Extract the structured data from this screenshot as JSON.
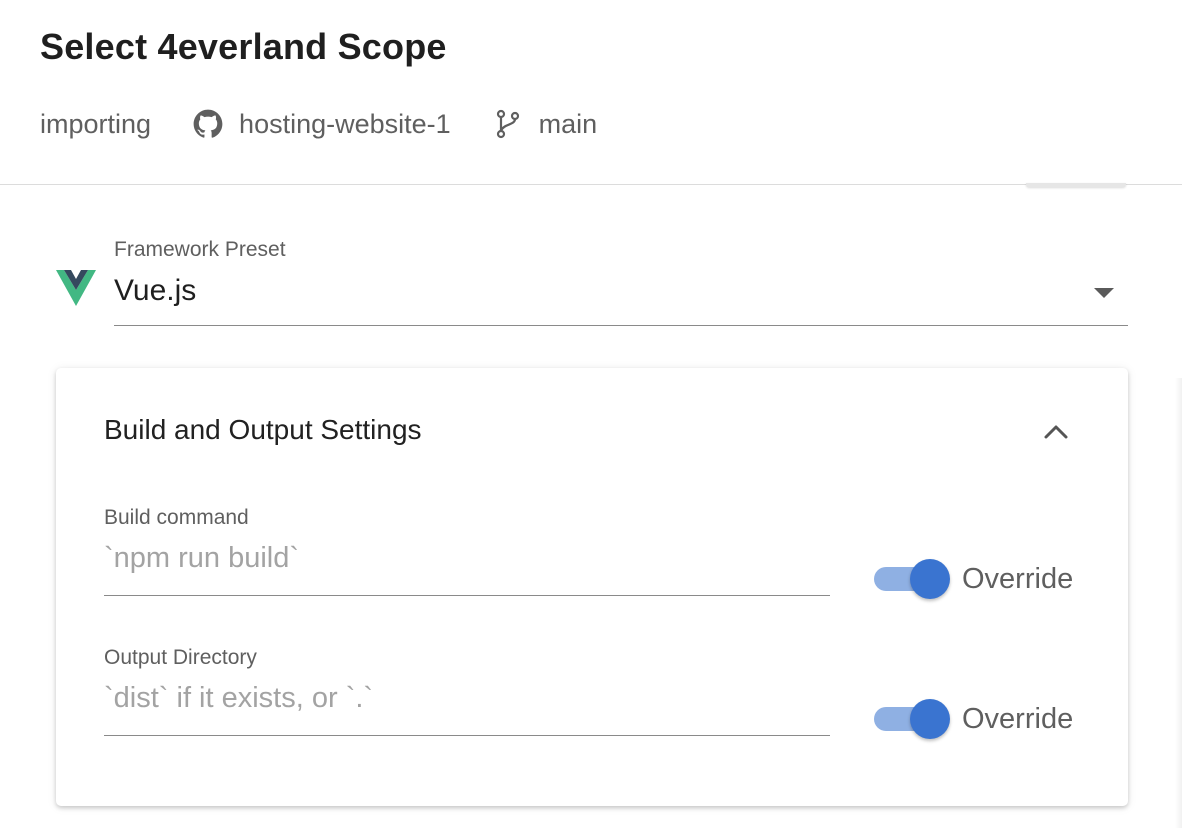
{
  "header": {
    "title": "Select 4everland Scope",
    "status": "importing",
    "repository": "hosting-website-1",
    "branch": "main",
    "repository_icon": "github-icon",
    "branch_icon": "git-branch-icon"
  },
  "framework": {
    "label": "Framework Preset",
    "value": "Vue.js",
    "logo": "vue-logo",
    "dropdown_icon": "caret-down-icon"
  },
  "build_settings": {
    "title": "Build and Output Settings",
    "collapse_icon": "chevron-up-icon",
    "fields": [
      {
        "label": "Build command",
        "value": "",
        "placeholder": "`npm run build`",
        "override_label": "Override",
        "override_enabled": true
      },
      {
        "label": "Output Directory",
        "value": "",
        "placeholder": "`dist` if it exists, or `.`",
        "override_label": "Override",
        "override_enabled": true
      }
    ]
  },
  "colors": {
    "accent": "#3a74d0",
    "switch_track": "#8fb0e3",
    "vue_green": "#42b883",
    "vue_dark": "#35495e"
  }
}
